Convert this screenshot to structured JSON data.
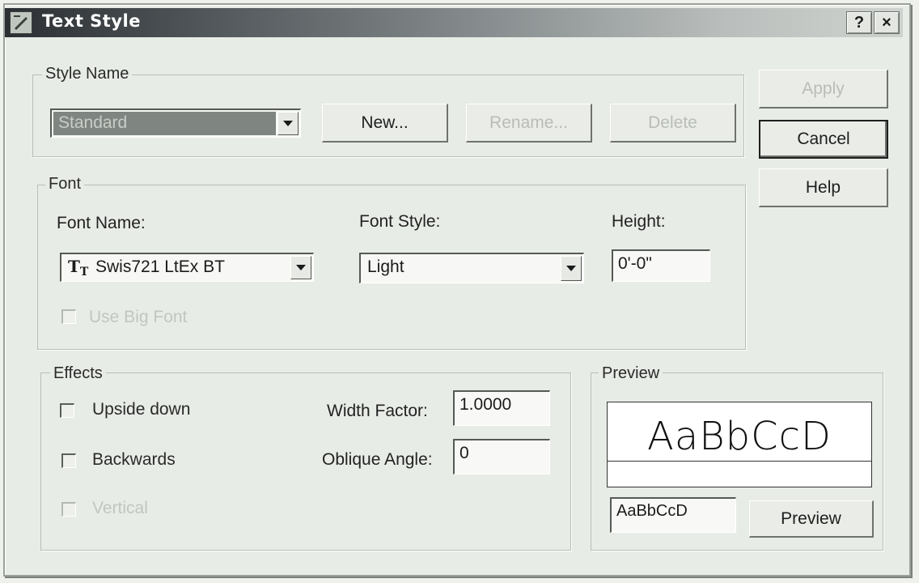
{
  "window": {
    "title": "Text Style",
    "help_glyph": "?",
    "close_glyph": "×"
  },
  "style_name": {
    "group_label": "Style Name",
    "selected": "Standard",
    "new_label": "New...",
    "rename_label": "Rename...",
    "delete_label": "Delete"
  },
  "side_buttons": {
    "apply_label": "Apply",
    "cancel_label": "Cancel",
    "help_label": "Help"
  },
  "font": {
    "group_label": "Font",
    "font_name_label": "Font Name:",
    "font_name_value": "Swis721 LtEx BT",
    "font_name_icon": "truetype-icon",
    "font_style_label": "Font Style:",
    "font_style_value": "Light",
    "height_label": "Height:",
    "height_value": "0'-0\"",
    "bigfont_label": "Use Big Font",
    "bigfont_checked": false
  },
  "effects": {
    "group_label": "Effects",
    "upside_down_label": "Upside down",
    "backwards_label": "Backwards",
    "vertical_label": "Vertical",
    "width_factor_label": "Width Factor:",
    "width_factor_value": "1.0000",
    "oblique_angle_label": "Oblique Angle:",
    "oblique_angle_value": "0"
  },
  "preview": {
    "group_label": "Preview",
    "sample_text": "AaBbCcD",
    "input_value": "AaBbCcD",
    "button_label": "Preview"
  }
}
